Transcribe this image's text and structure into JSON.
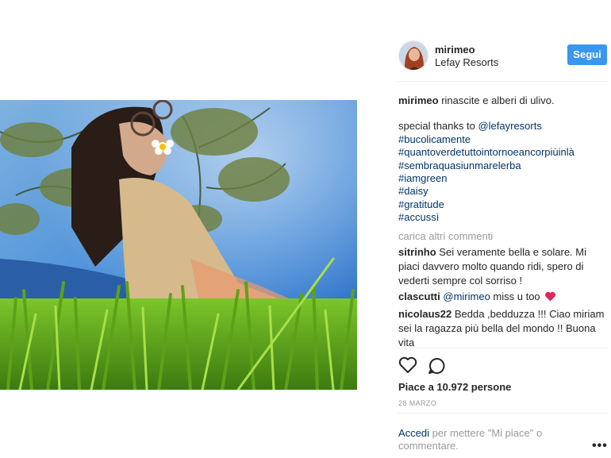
{
  "post": {
    "username": "mirimeo",
    "location": "Lefay Resorts",
    "follow_label": "Segui",
    "caption_text": "rinascite e alberi di ulivo.",
    "thanks_prefix": "special thanks to",
    "thanks_mention": "@lefayresorts",
    "hashtags": [
      "#bucolicamente",
      "#quantoverdetuttointornoeancorpiùinlà",
      "#sembraquasiunmarelerba",
      "#iamgreen",
      "#daisy",
      "#gratitude",
      "#accussì"
    ],
    "load_more": "carica altri commenti",
    "likes": "Piace a 10.972 persone",
    "date": "28 MARZO"
  },
  "comments": [
    {
      "user": "sitrinho",
      "text": "Sei veramente bella e solare. Mi piaci davvero molto quando ridi, spero di vederti sempre col sorriso !"
    },
    {
      "user": "clascutti",
      "mention": "@mirimeo",
      "text": "miss u too"
    },
    {
      "user": "nicolaus22",
      "text": "Bedda ,bedduzza !!! Ciao miriam sei la ragazza più bella del mondo !! Buona vita"
    }
  ],
  "login": {
    "link": "Accedi",
    "text": "per mettere \"Mi piace\" o commentare.",
    "more_icon": "•••"
  },
  "icons": {
    "like": "heart-outline-icon",
    "comment": "speech-bubble-icon",
    "emoji": "red-heart-emoji"
  },
  "colors": {
    "accent": "#3897f0",
    "link": "#003569",
    "muted": "#999999",
    "heart": "#ed4956"
  }
}
